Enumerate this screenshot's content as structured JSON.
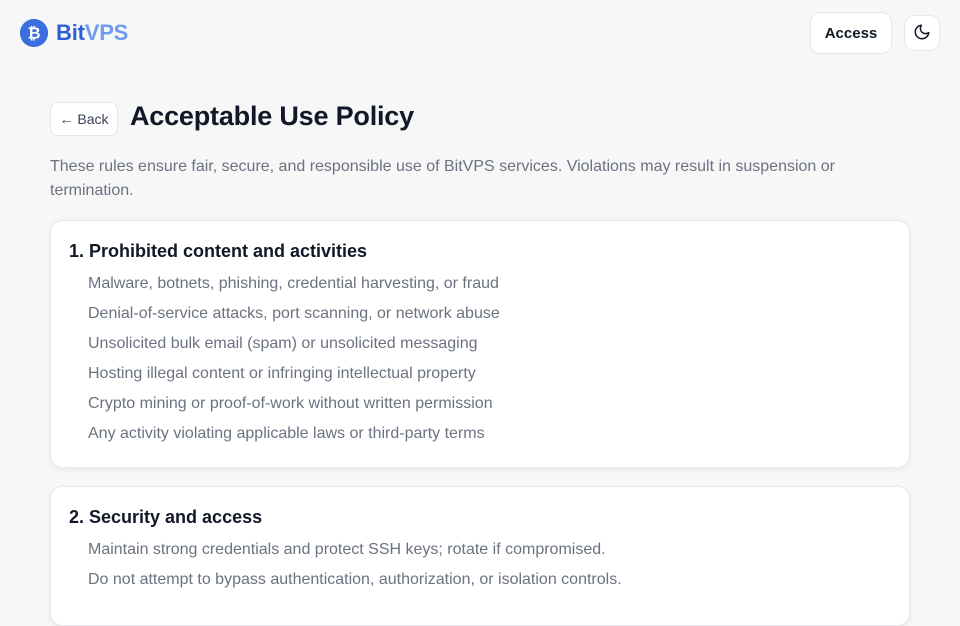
{
  "header": {
    "brand_part1": "Bit",
    "brand_part2": "VPS",
    "access_label": "Access",
    "logo_icon": "bitcoin-icon",
    "theme_icon": "moon-icon"
  },
  "page": {
    "back_label": "← Back",
    "title": "Acceptable Use Policy",
    "intro": "These rules ensure fair, secure, and responsible use of BitVPS services. Violations may result in suspension or termination."
  },
  "sections": [
    {
      "title": "1. Prohibited content and activities",
      "items": [
        "Malware, botnets, phishing, credential harvesting, or fraud",
        "Denial-of-service attacks, port scanning, or network abuse",
        "Unsolicited bulk email (spam) or unsolicited messaging",
        "Hosting illegal content or infringing intellectual property",
        "Crypto mining or proof-of-work without written permission",
        "Any activity violating applicable laws or third-party terms"
      ]
    },
    {
      "title": "2. Security and access",
      "items": [
        "Maintain strong credentials and protect SSH keys; rotate if compromised.",
        "Do not attempt to bypass authentication, authorization, or isolation controls."
      ]
    }
  ],
  "colors": {
    "brand_primary": "#2f5fd3",
    "brand_secondary": "#6e9af0",
    "logo_bg": "#3b6fe0"
  }
}
